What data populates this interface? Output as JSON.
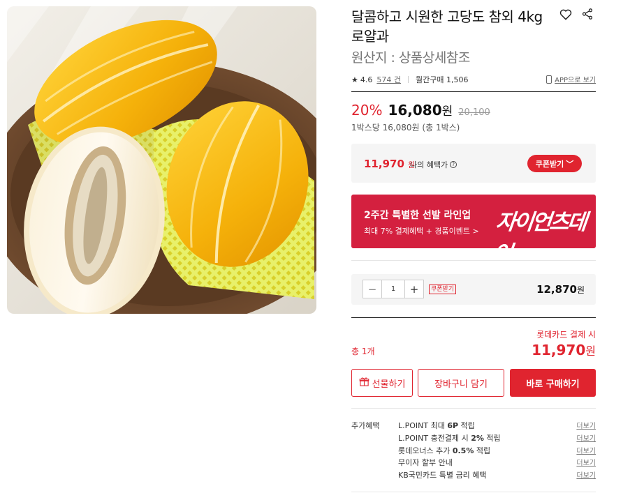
{
  "product": {
    "title": "달콤하고 시원한 고당도 참외 4kg 로얄과",
    "origin": "원산지 : 상품상세참조",
    "image_alt": "yellow-melon-photo"
  },
  "icons": {
    "wishlist": "heart-icon",
    "share": "share-icon"
  },
  "rating": {
    "star": "★",
    "score": "4.6",
    "reviews": "574 건",
    "monthly": "월간구매 1,506",
    "app_view": "APP으로 보기"
  },
  "price": {
    "discount": "20%",
    "sale": "16,080",
    "sale_unit": "원",
    "original": "20,100",
    "unit_price": "1박스당 16,080원 (총 1박스)"
  },
  "benefit": {
    "price": "11,970",
    "won": "원",
    "label": "나의 혜택가",
    "info_icon": "?",
    "coupon_button": "쿠폰받기",
    "coupon_chevron": "﹀"
  },
  "banner": {
    "title": "2주간 특별한 선발 라인업",
    "subtitle": "최대 7% 결제혜택 + 경품이벤트 >",
    "brand": "자이언츠데이"
  },
  "quantity": {
    "minus": "−",
    "value": "1",
    "plus": "+",
    "coupon": "쿠폰받기",
    "price": "12,870",
    "won": "원"
  },
  "total": {
    "count_label": "총 1개",
    "card_label": "롯데카드 결제 시",
    "price": "11,970",
    "won": "원"
  },
  "buttons": {
    "gift": "선물하기",
    "cart": "장바구니 담기",
    "buy": "바로 구매하기"
  },
  "extra_benefits": {
    "label": "추가혜택",
    "more": "더보기",
    "items": [
      {
        "pre": "L.POINT 최대 ",
        "bold": "6P",
        "post": " 적립"
      },
      {
        "pre": "L.POINT 충전결제 시 ",
        "bold": "2%",
        "post": " 적립"
      },
      {
        "pre": "롯데오너스 추가 ",
        "bold": "0.5%",
        "post": " 적립"
      },
      {
        "pre": "무이자 할부 안내",
        "bold": "",
        "post": ""
      },
      {
        "pre": "KB국민카드 특별 금리 혜택",
        "bold": "",
        "post": ""
      }
    ]
  },
  "colors": {
    "accent": "#e0242f",
    "banner": "#d4203f",
    "box_bg": "#f5f5f5"
  }
}
